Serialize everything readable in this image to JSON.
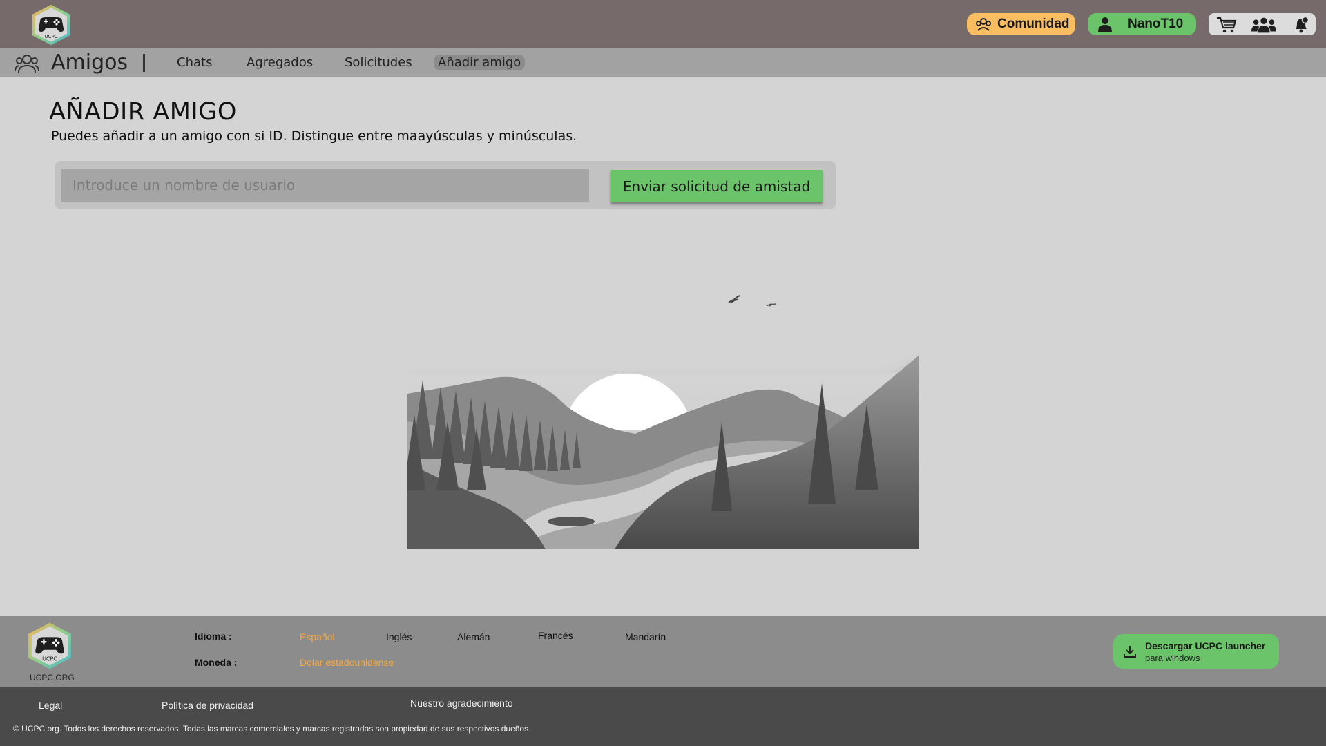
{
  "header": {
    "logo_text": "UCPC",
    "community_label": "Comunidad",
    "username": "NanoT10",
    "icons": [
      "cart-icon",
      "friends-icon",
      "notification-bell-icon"
    ],
    "colors": {
      "header_bg": "#766a6a",
      "community": "#fbbd62",
      "user": "#6cc46a"
    }
  },
  "subnav": {
    "title": "Amigos",
    "tabs": [
      {
        "label": "Chats",
        "active": false
      },
      {
        "label": "Agregados",
        "active": false
      },
      {
        "label": "Solicitudes",
        "active": false
      },
      {
        "label": "Añadir amigo",
        "active": true
      }
    ]
  },
  "main": {
    "title": "AÑADIR AMIGO",
    "subtitle": "Puedes añadir a un amigo con si ID. Distingue entre maayúsculas y minúsculas.",
    "input_placeholder": "Introduce un nombre de usuario",
    "input_value": "",
    "send_button": "Enviar solicitud de amistad",
    "illustration": "grayscale-landscape-illustration"
  },
  "footer": {
    "brand": "UCPC.ORG",
    "logo_text": "UCPC",
    "language_label": "Idioma :",
    "languages": [
      "Español",
      "Inglés",
      "Alemán",
      "Francés",
      "Mandarín"
    ],
    "selected_language": "Español",
    "currency_label": "Moneda :",
    "currency": "Dolar estadounidense",
    "download_title": "Descargar UCPC launcher",
    "download_subtitle": "para windows",
    "accent_color": "#f5a840"
  },
  "bottom": {
    "links": [
      "Legal",
      "Política de privacidad",
      "Nuestro agradecimiento"
    ],
    "copyright": "© UCPC org. Todos los derechos reservados. Todas las marcas comerciales y marcas registradas son propiedad de sus respectivos dueños."
  }
}
